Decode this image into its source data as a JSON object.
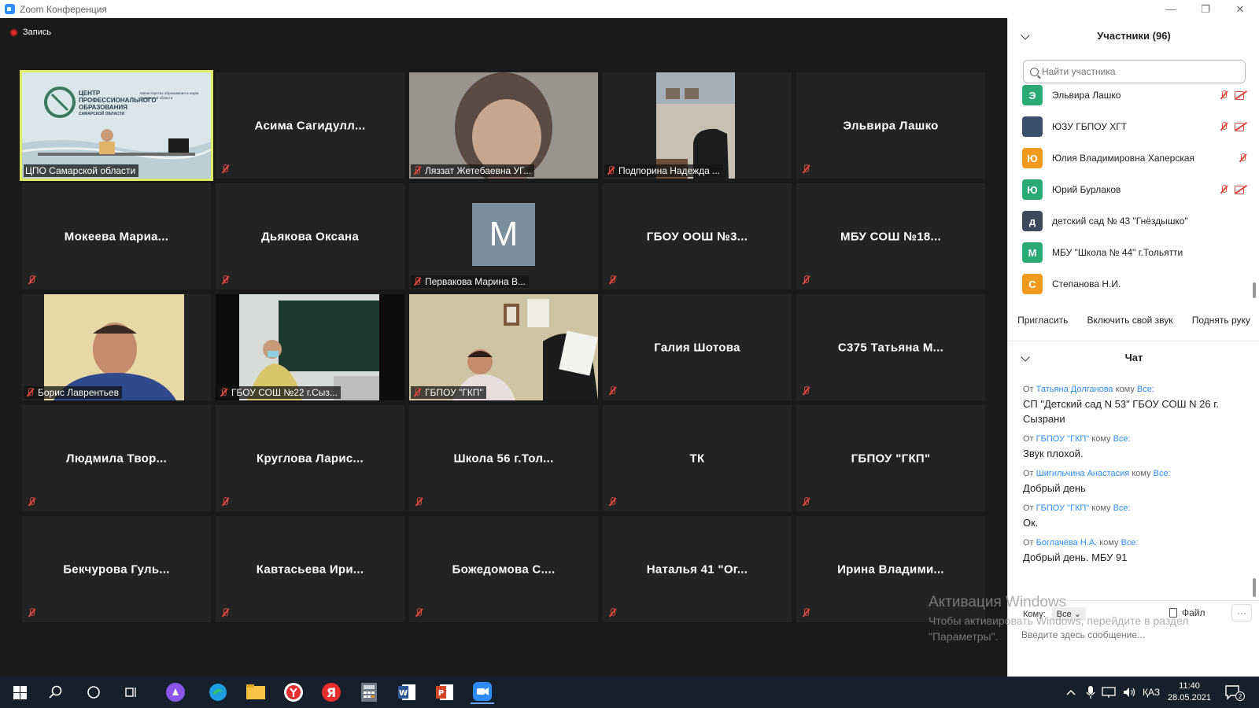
{
  "window": {
    "title": "Zoom Конференция",
    "minimize": "—",
    "maximize": "❐",
    "close": "✕"
  },
  "recording": {
    "label": "Запись"
  },
  "tiles": [
    {
      "label": "ЦПО Самарской области",
      "video": "cpo",
      "active": true
    },
    {
      "name": "Асима  Сагидулл...",
      "muted": true
    },
    {
      "label": "Ляззат Жетебаевна УГ...",
      "video": "face"
    },
    {
      "label": "Подпорина Надежда ...",
      "video": "office"
    },
    {
      "name": "Эльвира Лашко",
      "muted": true
    },
    {
      "name": "Мокеева  Мариа...",
      "muted": true
    },
    {
      "name": "Дьякова Оксана",
      "muted": true
    },
    {
      "label": "Первакова Марина В...",
      "avatar": "М"
    },
    {
      "name": "ГБОУ ООШ №3...",
      "muted": true
    },
    {
      "name": "МБУ СОШ №18...",
      "muted": true
    },
    {
      "label": "Борис Лаврентьев",
      "video": "man"
    },
    {
      "label": "ГБОУ СОШ №22 г.Сыз...",
      "video": "classroom"
    },
    {
      "label": "ГБПОУ \"ГКП\"",
      "video": "desk"
    },
    {
      "name": "Галия Шотова",
      "muted": true
    },
    {
      "name": "С375 Татьяна М...",
      "muted": true
    },
    {
      "name": "Людмила  Твор...",
      "muted": true
    },
    {
      "name": "Круглова  Ларис...",
      "muted": true
    },
    {
      "name": "Школа 56 г.Тол...",
      "muted": true
    },
    {
      "name": "ТК",
      "muted": true
    },
    {
      "name": "ГБПОУ \"ГКП\"",
      "muted": true
    },
    {
      "name": "Бекчурова  Гуль...",
      "muted": true
    },
    {
      "name": "Кавтасьева  Ири...",
      "muted": true
    },
    {
      "name": "Божедомова  С....",
      "muted": true
    },
    {
      "name": "Наталья 41 \"Ог...",
      "muted": true
    },
    {
      "name": "Ирина  Владими...",
      "muted": true
    }
  ],
  "cpo_logo": {
    "line1": "ЦЕНТР",
    "line2": "ПРОФЕССИОНАЛЬНОГО",
    "line3": "ОБРАЗОВАНИЯ",
    "line4": "САМАРСКОЙ ОБЛАСТИ",
    "ministry": "Министерство образования и науки Самарской области"
  },
  "participants": {
    "title": "Участники (96)",
    "search_placeholder": "Найти участника",
    "items": [
      {
        "initial": "Э",
        "name": "Эльвира Лашко",
        "color": "#2aa876",
        "mic_off": true,
        "cam_off": true
      },
      {
        "initial": "",
        "name": "ЮЗУ ГБПОУ ХГТ",
        "color": "#3a4f6e",
        "mic_off": true,
        "cam_off": true
      },
      {
        "initial": "Ю",
        "name": "Юлия Владимировна Хаперская",
        "color": "#f29a1d",
        "mic_off": true,
        "cam_off": false
      },
      {
        "initial": "Ю",
        "name": "Юрий Бурлаков",
        "color": "#2aa876",
        "mic_off": true,
        "cam_off": true
      },
      {
        "initial": "д",
        "name": "детский сад № 43 \"Гнёздышко\"",
        "color": "#3d4a5c",
        "mic_off": false,
        "cam_off": false
      },
      {
        "initial": "М",
        "name": "МБУ \"Школа № 44\" г.Тольятти",
        "color": "#2aa876",
        "mic_off": false,
        "cam_off": false
      },
      {
        "initial": "С",
        "name": "Степанова Н.И.",
        "color": "#f29a1d",
        "mic_off": false,
        "cam_off": false
      }
    ],
    "buttons": {
      "invite": "Пригласить",
      "unmute": "Включить свой звук",
      "raise_hand": "Поднять руку"
    }
  },
  "chat": {
    "title": "Чат",
    "from": "От",
    "to": "кому",
    "messages": [
      {
        "sender": "Татьяна Долганова",
        "recipient": "Все:",
        "text": "СП \"Детский сад N 53\" ГБОУ СОШ N 26 г. Сызрани"
      },
      {
        "sender": "ГБПОУ \"ГКП\"",
        "recipient": "Все:",
        "text": "Звук плохой."
      },
      {
        "sender": "Шигильчина Анастасия",
        "recipient": "Все:",
        "text": "Добрый день"
      },
      {
        "sender": "ГБПОУ \"ГКП\"",
        "recipient": "Все:",
        "text": "Ок."
      },
      {
        "sender": "Боглачёва Н.А.",
        "recipient": "Все:",
        "text": "Добрый день. МБУ 91"
      }
    ],
    "to_label": "Кому:",
    "to_value": "Все ⌄",
    "file_label": "Файл",
    "more": "···",
    "input_placeholder": "Введите здесь сообщение..."
  },
  "watermark": {
    "line1": "Активация Windows",
    "line2": "Чтобы активировать Windows, перейдите в раздел",
    "line3": "\"Параметры\"."
  },
  "taskbar": {
    "lang": "ҚАЗ",
    "time": "11:40",
    "date": "28.05.2021",
    "notifications": "2"
  }
}
